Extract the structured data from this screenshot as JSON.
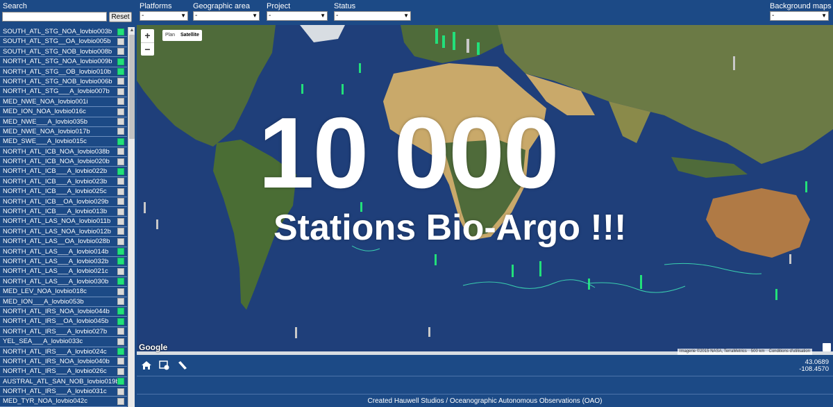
{
  "search": {
    "label": "Search",
    "value": "",
    "reset_label": "Reset"
  },
  "filters": [
    {
      "label": "Platforms",
      "value": "-"
    },
    {
      "label": "Geographic area",
      "value": "-"
    },
    {
      "label": "Project",
      "value": "-"
    },
    {
      "label": "Status",
      "value": "-"
    },
    {
      "label": "Background maps",
      "value": "-"
    }
  ],
  "floats": [
    {
      "name": "SOUTH_ATL_STG_NOA_lovbio003b",
      "active": true
    },
    {
      "name": "SOUTH_ATL_STG__OA_lovbio005b",
      "active": false
    },
    {
      "name": "SOUTH_ATL_STG_NOB_lovbio008b",
      "active": false
    },
    {
      "name": "NORTH_ATL_STG_NOA_lovbio009b",
      "active": true
    },
    {
      "name": "NORTH_ATL_STG__OB_lovbio010b",
      "active": true
    },
    {
      "name": "NORTH_ATL_STG_NOB_lovbio006b",
      "active": false
    },
    {
      "name": "NORTH_ATL_STG___A_lovbio007b",
      "active": false
    },
    {
      "name": "MED_NWE_NOA_lovbio001i",
      "active": false
    },
    {
      "name": "MED_ION_NOA_lovbio016c",
      "active": false
    },
    {
      "name": "MED_NWE___A_lovbio035b",
      "active": false
    },
    {
      "name": "MED_NWE_NOA_lovbio017b",
      "active": false
    },
    {
      "name": "MED_SWE___A_lovbio015c",
      "active": true
    },
    {
      "name": "NORTH_ATL_ICB_NOA_lovbio038b",
      "active": false
    },
    {
      "name": "NORTH_ATL_ICB_NOA_lovbio020b",
      "active": false
    },
    {
      "name": "NORTH_ATL_ICB___A_lovbio022b",
      "active": true
    },
    {
      "name": "NORTH_ATL_ICB___A_lovbio023b",
      "active": false
    },
    {
      "name": "NORTH_ATL_ICB___A_lovbio025c",
      "active": false
    },
    {
      "name": "NORTH_ATL_ICB__OA_lovbio029b",
      "active": false
    },
    {
      "name": "NORTH_ATL_ICB___A_lovbio013b",
      "active": false
    },
    {
      "name": "NORTH_ATL_LAS_NOA_lovbio011b",
      "active": false
    },
    {
      "name": "NORTH_ATL_LAS_NOA_lovbio012b",
      "active": false
    },
    {
      "name": "NORTH_ATL_LAS__OA_lovbio028b",
      "active": false
    },
    {
      "name": "NORTH_ATL_LAS___A_lovbio014b",
      "active": true
    },
    {
      "name": "NORTH_ATL_LAS___A_lovbio032b",
      "active": true
    },
    {
      "name": "NORTH_ATL_LAS___A_lovbio021c",
      "active": false
    },
    {
      "name": "NORTH_ATL_LAS___A_lovbio030b",
      "active": true
    },
    {
      "name": "MED_LEV_NOA_lovbio018c",
      "active": false
    },
    {
      "name": "MED_ION___A_lovbio053b",
      "active": false
    },
    {
      "name": "NORTH_ATL_IRS_NOA_lovbio044b",
      "active": true
    },
    {
      "name": "NORTH_ATL_IRS__OA_lovbio045b",
      "active": true
    },
    {
      "name": "NORTH_ATL_IRS___A_lovbio027b",
      "active": false
    },
    {
      "name": "YEL_SEA___A_lovbio033c",
      "active": false
    },
    {
      "name": "NORTH_ATL_IRS___A_lovbio024c",
      "active": true
    },
    {
      "name": "NORTH_ATL_IRS_NOA_lovbio040b",
      "active": false
    },
    {
      "name": "NORTH_ATL_IRS___A_lovbio026c",
      "active": false
    },
    {
      "name": "AUSTRAL_ATL_SAN_NOB_lovbio019b",
      "active": true
    },
    {
      "name": "NORTH_ATL_IRS___A_lovbio031c",
      "active": false
    },
    {
      "name": "MED_TYR_NOA_lovbio042c",
      "active": false
    }
  ],
  "map": {
    "zoom_in": "+",
    "zoom_out": "−",
    "type_plan": "Plan",
    "type_satellite": "Satellite",
    "headline": "10 000",
    "subheadline": "Stations Bio-Argo !!!",
    "google_logo": "Google",
    "attribution": "Imagerie ©2015 NASA, TerraMetrics",
    "scale": "500 km",
    "terms": "Conditions d'utilisation",
    "colors": {
      "ocean": "#1f3f7a",
      "land": "#4f6b3a",
      "desert": "#c9a96a",
      "ice": "#d8dde2",
      "active_float": "#22e07a",
      "inactive_float": "#c8c8c8"
    }
  },
  "coords": {
    "lat": "43.0689",
    "lon": "-108.4570"
  },
  "footer": "Created Hauwell Studios / Oceanographic Autonomous Observations (OAO)"
}
